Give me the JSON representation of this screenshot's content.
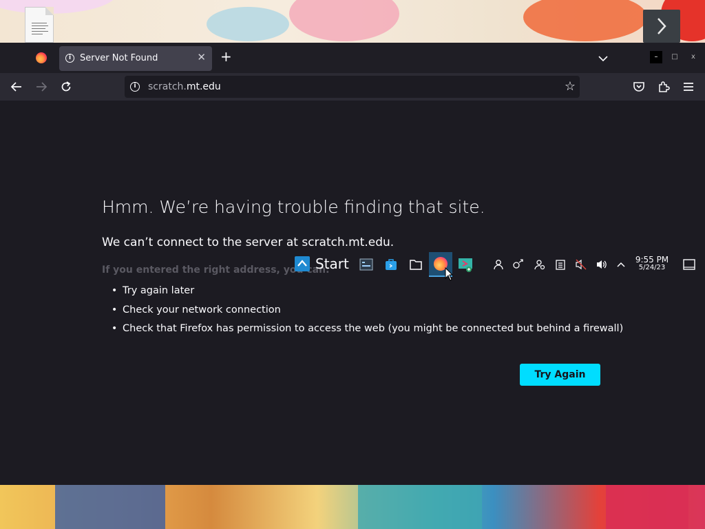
{
  "browser": {
    "tab_title": "Server Not Found",
    "url_prefix": "scratch.",
    "url_domain": "mt.edu",
    "window_controls": {
      "minimize": "–",
      "maximize": "□",
      "close": "x"
    }
  },
  "error_page": {
    "title": "Hmm. We’re having trouble finding that site.",
    "subtitle": "We can’t connect to the server at scratch.mt.edu.",
    "hint": "If you entered the right address, you can:",
    "suggestions": [
      "Try again later",
      "Check your network connection",
      "Check that Firefox has permission to access the web (you might be connected but behind a firewall)"
    ],
    "button_label": "Try Again"
  },
  "taskbar": {
    "start_label": "Start",
    "time": "9:55 PM",
    "date": "5/24/23"
  },
  "colors": {
    "page_bg": "#1c1b22",
    "accent_button": "#00ddff",
    "text": "#fbfbfe"
  }
}
